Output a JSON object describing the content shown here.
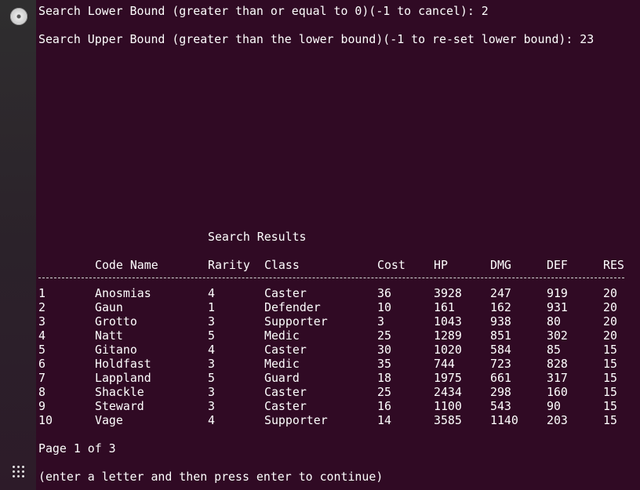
{
  "prompts": {
    "lower": "Search Lower Bound (greater than or equal to 0)(-1 to cancel): 2",
    "upper": "Search Upper Bound (greater than the lower bound)(-1 to re-set lower bound): 23"
  },
  "results": {
    "title": "Search Results",
    "headers": [
      "Code Name",
      "Rarity",
      "Class",
      "Cost",
      "HP",
      "DMG",
      "DEF",
      "RES"
    ],
    "rows": [
      [
        "1",
        "Anosmias",
        "4",
        "Caster",
        "36",
        "3928",
        "247",
        "919",
        "20"
      ],
      [
        "2",
        "Gaun",
        "1",
        "Defender",
        "10",
        "161",
        "162",
        "931",
        "20"
      ],
      [
        "3",
        "Grotto",
        "3",
        "Supporter",
        "3",
        "1043",
        "938",
        "80",
        "20"
      ],
      [
        "4",
        "Natt",
        "5",
        "Medic",
        "25",
        "1289",
        "851",
        "302",
        "20"
      ],
      [
        "5",
        "Gitano",
        "4",
        "Caster",
        "30",
        "1020",
        "584",
        "85",
        "15"
      ],
      [
        "6",
        "Holdfast",
        "3",
        "Medic",
        "35",
        "744",
        "723",
        "828",
        "15"
      ],
      [
        "7",
        "Lappland",
        "5",
        "Guard",
        "18",
        "1975",
        "661",
        "317",
        "15"
      ],
      [
        "8",
        "Shackle",
        "3",
        "Caster",
        "25",
        "2434",
        "298",
        "160",
        "15"
      ],
      [
        "9",
        "Steward",
        "3",
        "Caster",
        "16",
        "1100",
        "543",
        "90",
        "15"
      ],
      [
        "10",
        "Vage",
        "4",
        "Supporter",
        "14",
        "3585",
        "1140",
        "203",
        "15"
      ]
    ]
  },
  "footer": {
    "page": "Page 1 of 3",
    "hint": "(enter a letter and then press enter to continue)"
  },
  "icons": {
    "dock_top": "disc-icon",
    "dock_bottom": "show-applications-icon"
  },
  "colors": {
    "terminal_background": "#300a24",
    "text": "#ffffff"
  }
}
